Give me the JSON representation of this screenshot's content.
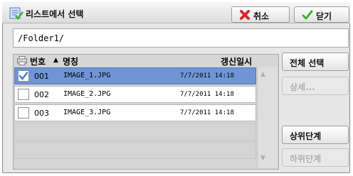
{
  "window": {
    "title": "리스트에서 선택",
    "cancel_label": "취소",
    "close_label": "닫기"
  },
  "path": {
    "value": "/Folder1/"
  },
  "list": {
    "columns": {
      "number": "번호",
      "name": "명칭",
      "date": "갱신일시"
    },
    "sort_indicator": "▲",
    "rows": [
      {
        "number": "001",
        "name": "IMAGE_1.JPG",
        "date": "7/7/2011 14:18",
        "checked": true
      },
      {
        "number": "002",
        "name": "IMAGE_2.JPG",
        "date": "7/7/2011 14:18",
        "checked": false
      },
      {
        "number": "003",
        "name": "IMAGE_3.JPG",
        "date": "7/7/2011 14:18",
        "checked": false
      }
    ]
  },
  "scroll": {
    "up": "▲",
    "down": "▼"
  },
  "side": {
    "select_all": "전체 선택",
    "details": "상세...",
    "upper_level": "상위단계",
    "lower_level": "하위단계"
  },
  "colors": {
    "selected_row": "#6f95d6",
    "cancel_icon": "#d62a2a",
    "check_icon": "#3fae2e"
  }
}
